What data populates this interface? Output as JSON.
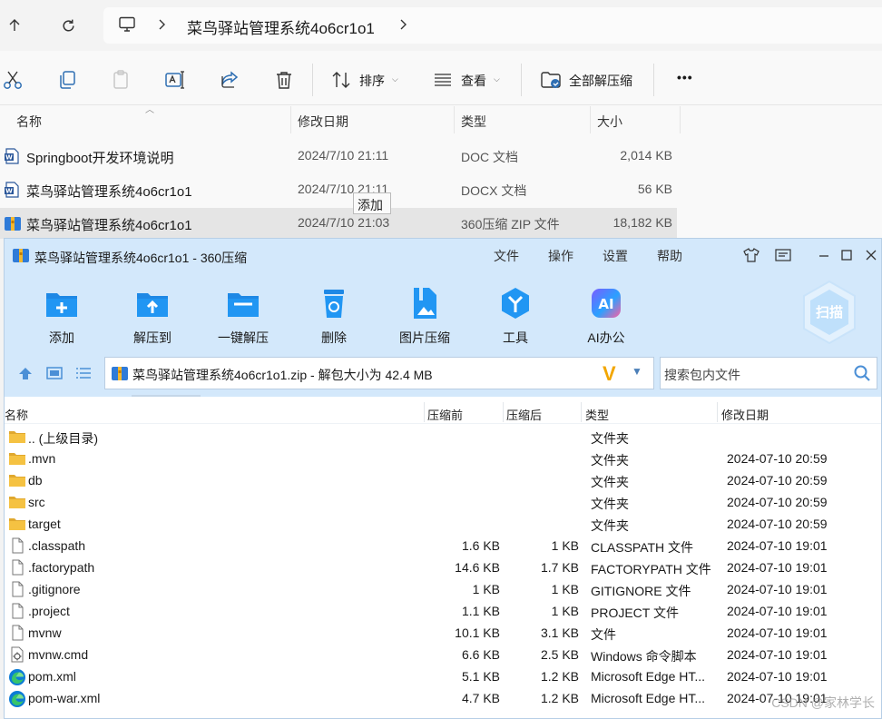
{
  "explorer": {
    "path": "菜鸟驿站管理系统4o6cr1o1",
    "commands": {
      "sort_label": "排序",
      "view_label": "查看",
      "extract_all_label": "全部解压缩",
      "more_label": "•••"
    },
    "columns": [
      "名称",
      "修改日期",
      "类型",
      "大小"
    ],
    "files": [
      {
        "name": "Springboot开发环境说明",
        "date": "2024/7/10 21:11",
        "type": "DOC 文档",
        "size": "2,014 KB",
        "icon": "word-doc-icon"
      },
      {
        "name": "菜鸟驿站管理系统4o6cr1o1",
        "date": "2024/7/10 21:11",
        "type": "DOCX 文档",
        "size": "56 KB",
        "icon": "word-docx-icon"
      },
      {
        "name": "菜鸟驿站管理系统4o6cr1o1",
        "date": "2024/7/10 21:03",
        "type": "360压缩 ZIP 文件",
        "size": "18,182 KB",
        "icon": "zip-archive-icon"
      }
    ],
    "tooltip": "添加"
  },
  "zip": {
    "title": "菜鸟驿站管理系统4o6cr1o1 - 360压缩",
    "menu": [
      "文件",
      "操作",
      "设置",
      "帮助"
    ],
    "toolbar": [
      {
        "label": "添加",
        "icon": "add-icon"
      },
      {
        "label": "解压到",
        "icon": "extract-to-icon"
      },
      {
        "label": "一键解压",
        "icon": "one-click-extract-icon"
      },
      {
        "label": "删除",
        "icon": "delete-icon"
      },
      {
        "label": "图片压缩",
        "icon": "image-compress-icon"
      },
      {
        "label": "工具",
        "icon": "tools-icon"
      },
      {
        "label": "AI办公",
        "icon": "ai-office-icon"
      }
    ],
    "scan_label": "扫描",
    "ai_badge": "AI",
    "address": "菜鸟驿站管理系统4o6cr1o1.zip - 解包大小为 42.4 MB",
    "search_placeholder": "搜索包内文件",
    "columns": {
      "name": "名称",
      "before": "压缩前",
      "after": "压缩后",
      "type": "类型",
      "date": "修改日期"
    },
    "files": [
      {
        "name": ".. (上级目录)",
        "before": "",
        "after": "",
        "type": "文件夹",
        "date": "",
        "icon": "folder-icon"
      },
      {
        "name": ".mvn",
        "before": "",
        "after": "",
        "type": "文件夹",
        "date": "2024-07-10 20:59",
        "icon": "folder-icon"
      },
      {
        "name": "db",
        "before": "",
        "after": "",
        "type": "文件夹",
        "date": "2024-07-10 20:59",
        "icon": "folder-icon"
      },
      {
        "name": "src",
        "before": "",
        "after": "",
        "type": "文件夹",
        "date": "2024-07-10 20:59",
        "icon": "folder-icon"
      },
      {
        "name": "target",
        "before": "",
        "after": "",
        "type": "文件夹",
        "date": "2024-07-10 20:59",
        "icon": "folder-icon"
      },
      {
        "name": ".classpath",
        "before": "1.6 KB",
        "after": "1 KB",
        "type": "CLASSPATH 文件",
        "date": "2024-07-10 19:01",
        "icon": "file-icon"
      },
      {
        "name": ".factorypath",
        "before": "14.6 KB",
        "after": "1.7 KB",
        "type": "FACTORYPATH 文件",
        "date": "2024-07-10 19:01",
        "icon": "file-icon"
      },
      {
        "name": ".gitignore",
        "before": "1 KB",
        "after": "1 KB",
        "type": "GITIGNORE 文件",
        "date": "2024-07-10 19:01",
        "icon": "file-icon"
      },
      {
        "name": ".project",
        "before": "1.1 KB",
        "after": "1 KB",
        "type": "PROJECT 文件",
        "date": "2024-07-10 19:01",
        "icon": "file-icon"
      },
      {
        "name": "mvnw",
        "before": "10.1 KB",
        "after": "3.1 KB",
        "type": "文件",
        "date": "2024-07-10 19:01",
        "icon": "file-icon"
      },
      {
        "name": "mvnw.cmd",
        "before": "6.6 KB",
        "after": "2.5 KB",
        "type": "Windows 命令脚本",
        "date": "2024-07-10 19:01",
        "icon": "cmd-script-icon"
      },
      {
        "name": "pom.xml",
        "before": "5.1 KB",
        "after": "1.2 KB",
        "type": "Microsoft Edge HT...",
        "date": "2024-07-10 19:01",
        "icon": "edge-icon"
      },
      {
        "name": "pom-war.xml",
        "before": "4.7 KB",
        "after": "1.2 KB",
        "type": "Microsoft Edge HT...",
        "date": "2024-07-10 19:01",
        "icon": "edge-icon"
      }
    ]
  },
  "watermark": "CSDN @家林学长",
  "colors": {
    "zip_chrome": "#d3e8fb",
    "selection": "#e5e5e5",
    "folder": "#f5c242",
    "accent_blue": "#1e88e5"
  }
}
